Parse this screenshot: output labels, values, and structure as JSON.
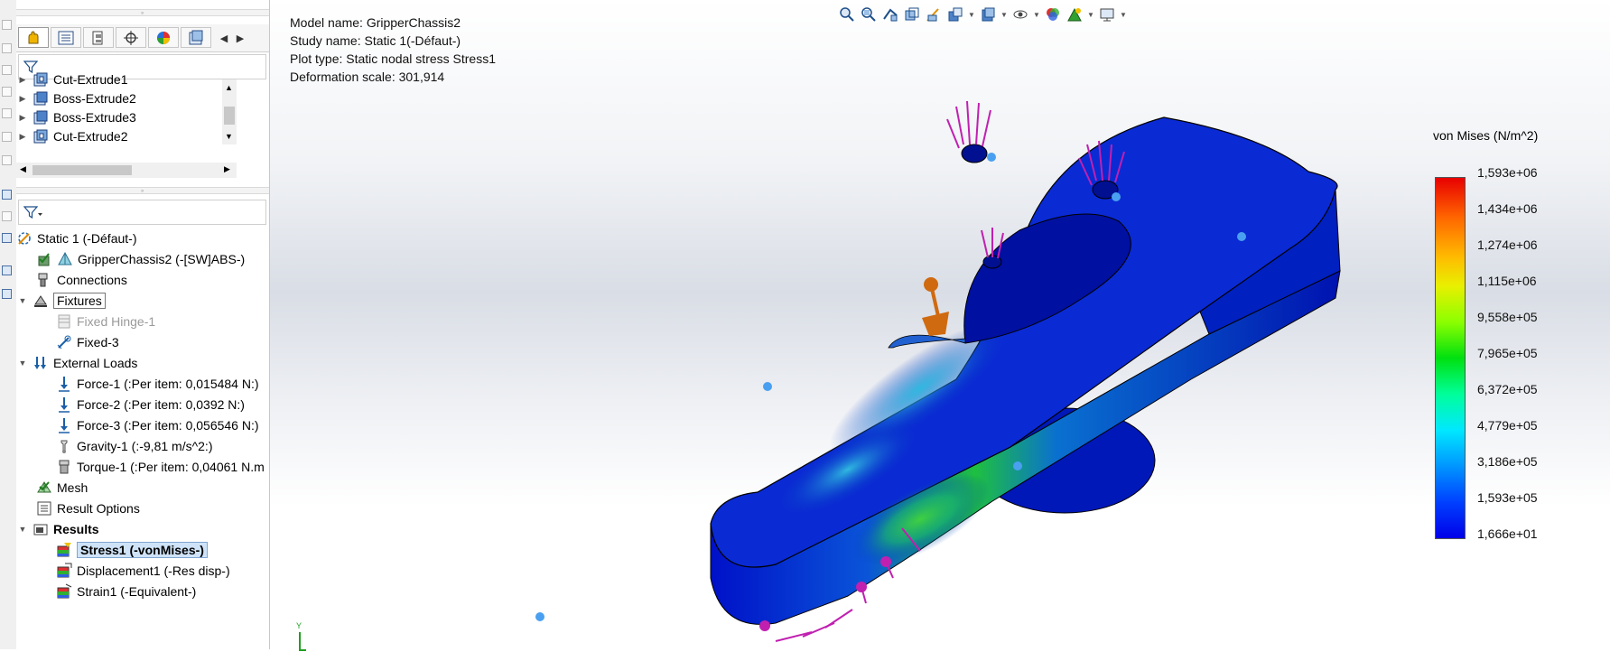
{
  "tree_top": {
    "items": [
      "Cut-Extrude1",
      "Boss-Extrude2",
      "Boss-Extrude3",
      "Cut-Extrude2"
    ]
  },
  "tree": {
    "study": "Static 1 (-Défaut-)",
    "part": "GripperChassis2 (-[SW]ABS-)",
    "connections": "Connections",
    "fixtures": "Fixtures",
    "fixed_hinge": "Fixed Hinge-1",
    "fixed3": "Fixed-3",
    "external_loads": "External Loads",
    "force1": "Force-1 (:Per item: 0,015484 N:)",
    "force2": "Force-2 (:Per item: 0,0392 N:)",
    "force3": "Force-3 (:Per item: 0,056546 N:)",
    "gravity": "Gravity-1 (:-9,81 m/s^2:)",
    "torque": "Torque-1 (:Per item: 0,04061 N.m",
    "mesh": "Mesh",
    "result_options": "Result Options",
    "results": "Results",
    "stress": "Stress1 (-vonMises-)",
    "displacement": "Displacement1 (-Res disp-)",
    "strain": "Strain1 (-Equivalent-)"
  },
  "info": {
    "model": "Model name: GripperChassis2",
    "study": "Study name: Static 1(-Défaut-)",
    "plot": "Plot type: Static nodal stress Stress1",
    "deformation": "Deformation scale: 301,914"
  },
  "legend": {
    "title": "von Mises (N/m^2)",
    "values": [
      "1,593e+06",
      "1,434e+06",
      "1,274e+06",
      "1,115e+06",
      "9,558e+05",
      "7,965e+05",
      "6,372e+05",
      "4,779e+05",
      "3,186e+05",
      "1,593e+05",
      "1,666e+01"
    ],
    "colors": [
      "#e80000",
      "#ff6600",
      "#ffbb00",
      "#e8f000",
      "#8cff00",
      "#00e010",
      "#00ff9a",
      "#00e8ff",
      "#0096ff",
      "#0040ff",
      "#0000e8"
    ]
  },
  "triad": {
    "y_label": "Y"
  },
  "colors": {
    "selection": "#cfe3f8",
    "load_arrows": "#c020b0",
    "fixture_handle": "#d06a10"
  }
}
